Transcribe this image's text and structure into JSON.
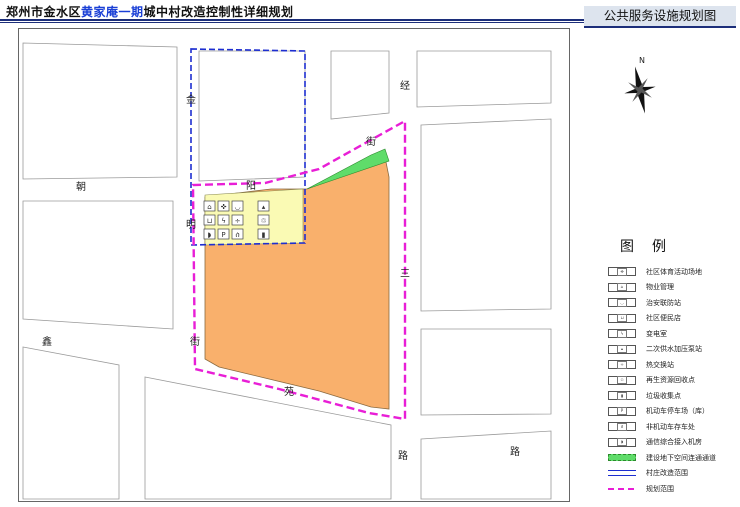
{
  "header": {
    "title_prefix": "郑州市金水区",
    "title_highlight": "黄家庵一期",
    "title_suffix": "城中村改造控制性详细规划",
    "panel_title": "公共服务设施规划图"
  },
  "map": {
    "north_label": "N",
    "road_labels": {
      "jin": "金",
      "ming": "明",
      "jie_left": "街",
      "chao": "朝",
      "yang": "阳",
      "jie_top": "街",
      "jing": "经",
      "san": "三",
      "lu_right": "路",
      "xin": "鑫",
      "yuan": "苑",
      "lu_bottom": "路"
    },
    "colors": {
      "site": "#f9b06c",
      "yellow_zone": "#fafab4",
      "green_strip": "#5fdc6a",
      "plan_boundary": "#e81ed6",
      "village_boundary": "#1d2ed0",
      "road_edge": "#9a9a9a"
    },
    "facility_icons": [
      "property-management-icon",
      "sports-icon",
      "security-icon",
      "pump-station-icon",
      "convenience-store-icon",
      "substation-icon",
      "heat-exchange-icon",
      "recycling-icon",
      "telecom-icon",
      "parking-icon",
      "bicycle-parking-icon",
      "garbage-icon"
    ]
  },
  "legend": {
    "title": "图例",
    "items": [
      {
        "label": "社区体育活动场地",
        "icon": "sports-icon",
        "glyph": "✜"
      },
      {
        "label": "物业管理",
        "icon": "property-management-icon",
        "glyph": "⌂"
      },
      {
        "label": "治安联防站",
        "icon": "security-icon",
        "glyph": "◡"
      },
      {
        "label": "社区便民店",
        "icon": "convenience-store-icon",
        "glyph": "⊔"
      },
      {
        "label": "变电室",
        "icon": "substation-icon",
        "glyph": "ϟ"
      },
      {
        "label": "二次供水加压泵站",
        "icon": "pump-station-icon",
        "glyph": "▴"
      },
      {
        "label": "热交换站",
        "icon": "heat-exchange-icon",
        "glyph": "÷"
      },
      {
        "label": "再生资源回收点",
        "icon": "recycling-icon",
        "glyph": "♲"
      },
      {
        "label": "垃圾收集点",
        "icon": "garbage-icon",
        "glyph": "▮"
      },
      {
        "label": "机动车停车场（库）",
        "icon": "parking-icon",
        "glyph": "P"
      },
      {
        "label": "非机动车存车处",
        "icon": "bicycle-parking-icon",
        "glyph": "ሰ"
      },
      {
        "label": "通信综合接入机房",
        "icon": "telecom-icon",
        "glyph": "◗"
      },
      {
        "label": "建设地下空间连通通道",
        "icon": "underground-passage-swatch",
        "glyph": ""
      },
      {
        "label": "村庄改造范围",
        "icon": "village-boundary-swatch",
        "glyph": ""
      },
      {
        "label": "规划范围",
        "icon": "plan-boundary-swatch",
        "glyph": ""
      }
    ]
  }
}
